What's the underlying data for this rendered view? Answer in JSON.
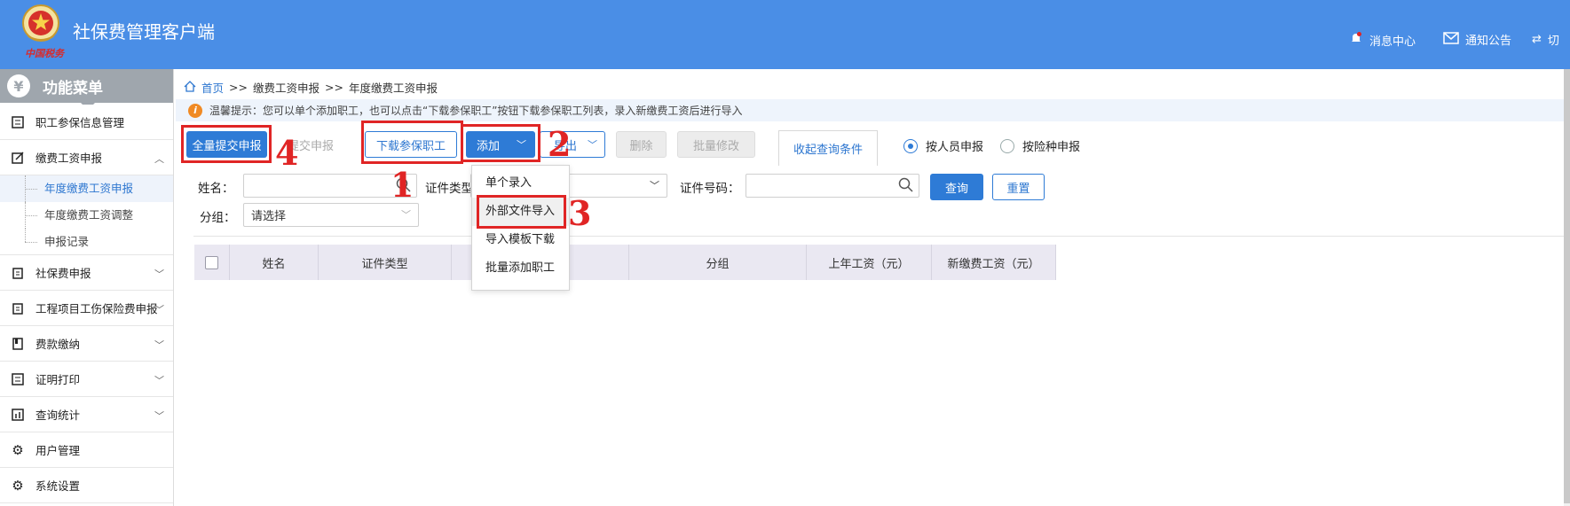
{
  "header": {
    "app_title": "社保费管理客户端",
    "logo_text": "中国税务",
    "message_center": "消息中心",
    "notice": "通知公告",
    "switch": "切",
    "bg_color": "#4a8ee6"
  },
  "sidebar": {
    "title": "功能菜单",
    "items": [
      {
        "label": "职工参保信息管理",
        "icon": "list-icon"
      },
      {
        "label": "缴费工资申报",
        "icon": "edit-icon"
      },
      {
        "label": "社保费申报",
        "icon": "clipboard-icon"
      },
      {
        "label": "工程项目工伤保险费申报",
        "icon": "clipboard-icon"
      },
      {
        "label": "费款缴纳",
        "icon": "book-icon"
      },
      {
        "label": "证明打印",
        "icon": "list-icon"
      },
      {
        "label": "查询统计",
        "icon": "chart-icon"
      },
      {
        "label": "用户管理",
        "icon": "gear-icon"
      },
      {
        "label": "系统设置",
        "icon": "gear-icon"
      }
    ],
    "sub_items": [
      "年度缴费工资申报",
      "年度缴费工资调整",
      "申报记录"
    ]
  },
  "breadcrumb": {
    "home": "首页",
    "sep": ">>",
    "level1": "缴费工资申报",
    "level2": "年度缴费工资申报"
  },
  "tip": "温馨提示：您可以单个添加职工，也可以点击“下载参保职工”按钮下载参保职工列表，录入新缴费工资后进行导入",
  "toolbar": {
    "submit_all": "全量提交申报",
    "submit": "提交申报",
    "download": "下载参保职工",
    "add": "添加",
    "export": "导出",
    "delete": "删除",
    "batch_edit": "批量修改",
    "fold_query": "收起查询条件",
    "radio_by_person": "按人员申报",
    "radio_by_insurance": "按险种申报"
  },
  "add_menu": [
    "单个录入",
    "外部文件导入",
    "导入模板下载",
    "批量添加职工"
  ],
  "search": {
    "name_label": "姓名：",
    "id_type_label": "证件类型",
    "id_no_label": "证件号码：",
    "group_label": "分组：",
    "group_value": "请选择",
    "query_btn": "查询",
    "reset_btn": "重置"
  },
  "table": {
    "headers": [
      "姓名",
      "证件类型",
      "分组",
      "上年工资（元）",
      "新缴费工资（元）"
    ]
  },
  "annotations": {
    "n1": "1",
    "n2": "2",
    "n3": "3",
    "n4": "4",
    "color": "#e02525"
  }
}
